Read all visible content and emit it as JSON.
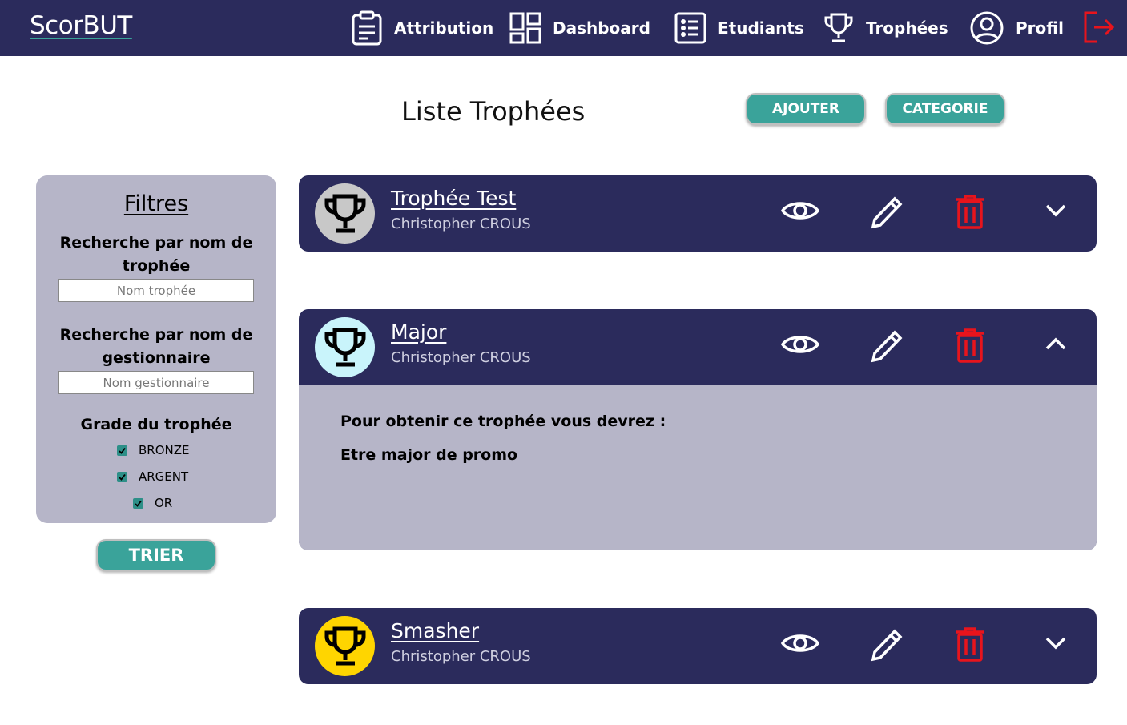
{
  "app": {
    "brand": "ScorBUT"
  },
  "nav": {
    "attribution": "Attribution",
    "dashboard": "Dashboard",
    "etudiants": "Etudiants",
    "trophees": "Trophées",
    "profil": "Profil"
  },
  "header": {
    "title": "Liste Trophées",
    "add_label": "AJOUTER",
    "category_label": "CATEGORIE"
  },
  "filters": {
    "title": "Filtres",
    "name_search_label": "Recherche par nom de trophée",
    "name_placeholder": "Nom trophée",
    "manager_search_label": "Recherche par nom de gestionnaire",
    "manager_placeholder": "Nom gestionnaire",
    "grade_label": "Grade du trophée",
    "grades": [
      {
        "label": "BRONZE",
        "checked": true
      },
      {
        "label": "ARGENT",
        "checked": true
      },
      {
        "label": "OR",
        "checked": true
      }
    ],
    "sort_label": "TRIER"
  },
  "trophies": [
    {
      "name": "Trophée Test",
      "owner": "Christopher CROUS",
      "color": "#c8c8c8",
      "expanded": false
    },
    {
      "name": "Major",
      "owner": "Christopher CROUS",
      "color": "#c9f4fb",
      "expanded": true,
      "detail_intro": "Pour obtenir ce trophée vous devrez :",
      "detail_condition": "Etre major de promo"
    },
    {
      "name": "Smasher",
      "owner": "Christopher CROUS",
      "color": "#ffd500",
      "expanded": false
    }
  ],
  "colors": {
    "navbar": "#2b2b5c",
    "accent": "#3aa39a",
    "danger": "#e8141c",
    "panel": "#b6b5c8"
  }
}
